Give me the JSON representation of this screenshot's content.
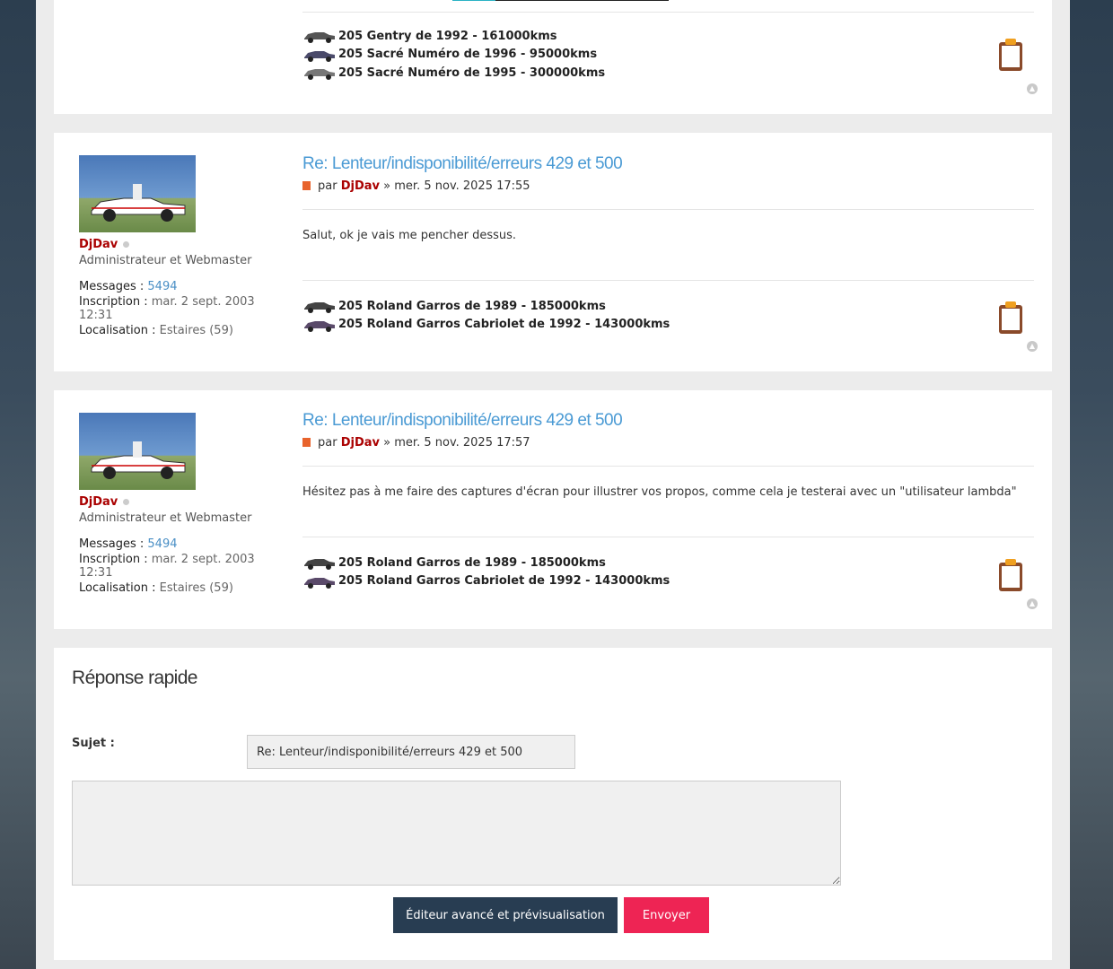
{
  "posts": [
    {
      "signature": [
        "205 Gentry de 1992 - 161000kms",
        "205 Sacré Numéro de 1996 - 95000kms",
        "205 Sacré Numéro de 1995 - 300000kms"
      ]
    },
    {
      "title": "Re: Lenteur/indisponibilité/erreurs 429 et 500",
      "by_label": "par",
      "author": "DjDav",
      "date_sep": "»",
      "date": "mer. 5 nov. 2025 17:55",
      "content": "Salut, ok je vais me pencher dessus.",
      "profile": {
        "username": "DjDav",
        "rank": "Administrateur et Webmaster",
        "messages_label": "Messages :",
        "messages_value": "5494",
        "joined_label": "Inscription :",
        "joined_value": "mar. 2 sept. 2003 12:31",
        "location_label": "Localisation :",
        "location_value": "Estaires (59)"
      },
      "signature": [
        "205 Roland Garros de 1989 - 185000kms",
        "205 Roland Garros Cabriolet de 1992 - 143000kms"
      ]
    },
    {
      "title": "Re: Lenteur/indisponibilité/erreurs 429 et 500",
      "by_label": "par",
      "author": "DjDav",
      "date_sep": "»",
      "date": "mer. 5 nov. 2025 17:57",
      "content": "Hésitez pas à me faire des captures d'écran pour illustrer vos propos, comme cela je testerai avec un \"utilisateur lambda\"",
      "profile": {
        "username": "DjDav",
        "rank": "Administrateur et Webmaster",
        "messages_label": "Messages :",
        "messages_value": "5494",
        "joined_label": "Inscription :",
        "joined_value": "mar. 2 sept. 2003 12:31",
        "location_label": "Localisation :",
        "location_value": "Estaires (59)"
      },
      "signature": [
        "205 Roland Garros de 1989 - 185000kms",
        "205 Roland Garros Cabriolet de 1992 - 143000kms"
      ]
    }
  ],
  "quick_reply": {
    "heading": "Réponse rapide",
    "subject_label": "Sujet :",
    "subject_value": "Re: Lenteur/indisponibilité/erreurs 429 et 500",
    "message_value": "",
    "advanced_button": "Éditeur avancé et prévisualisation",
    "submit_button": "Envoyer"
  },
  "colors": {
    "accent_link": "#4a9ad4",
    "author": "#aa0000",
    "button_dark": "#283d52",
    "button_red": "#ee2454"
  },
  "icons": {
    "post_icon": "post-file-icon",
    "quote": "clipboard-quote-icon",
    "top": "back-to-top-icon",
    "status": "offline-status-icon",
    "signature_car": "car-icon"
  }
}
